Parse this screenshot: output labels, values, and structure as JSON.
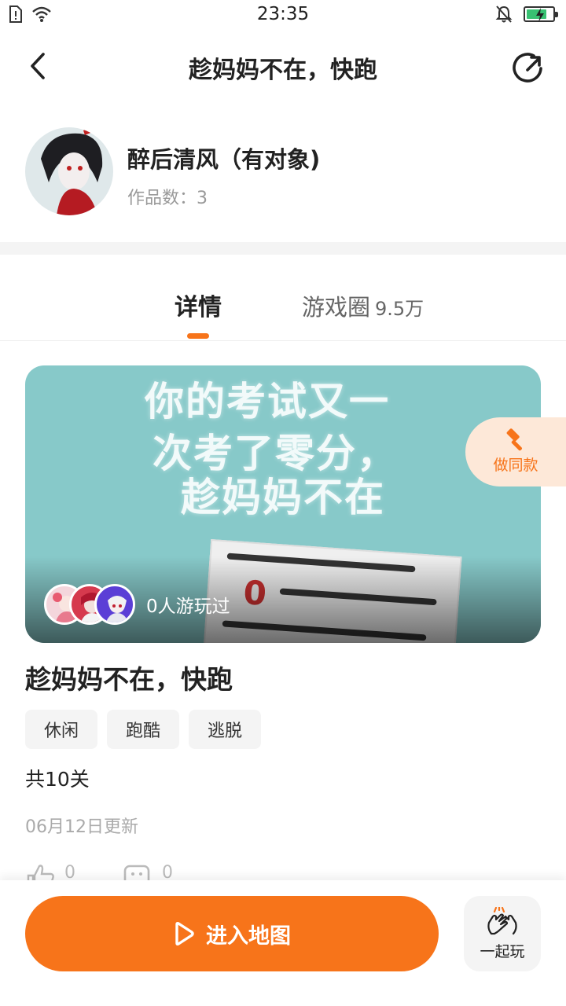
{
  "status_bar": {
    "time": "23:35"
  },
  "nav": {
    "title": "趁妈妈不在，快跑"
  },
  "author": {
    "name": "醉后清风（有对象)",
    "works_count": "作品数：3"
  },
  "tabs": [
    {
      "label": "详情",
      "active": true
    },
    {
      "label": "游戏圈",
      "count": "9.5万",
      "active": false
    }
  ],
  "banner": {
    "text_lines": [
      "你的考试又一",
      "次考了零分，",
      "趁妈妈不在"
    ],
    "paper_mark": "0",
    "played_text": "0人游玩过"
  },
  "side_button": {
    "label": "做同款",
    "icon": "hammer-icon"
  },
  "game": {
    "title": "趁妈妈不在，快跑",
    "tags": [
      "休闲",
      "跑酷",
      "逃脱"
    ],
    "levels": "共10关",
    "update_time": "06月12日更新"
  },
  "reactions": {
    "likes": "0",
    "comments": "0"
  },
  "bottom": {
    "enter_label": "进入地图",
    "play_together_label": "一起玩"
  },
  "colors": {
    "accent": "#f7741a",
    "banner_bg": "#87c9c9",
    "side_button_bg": "#fde8d8"
  }
}
